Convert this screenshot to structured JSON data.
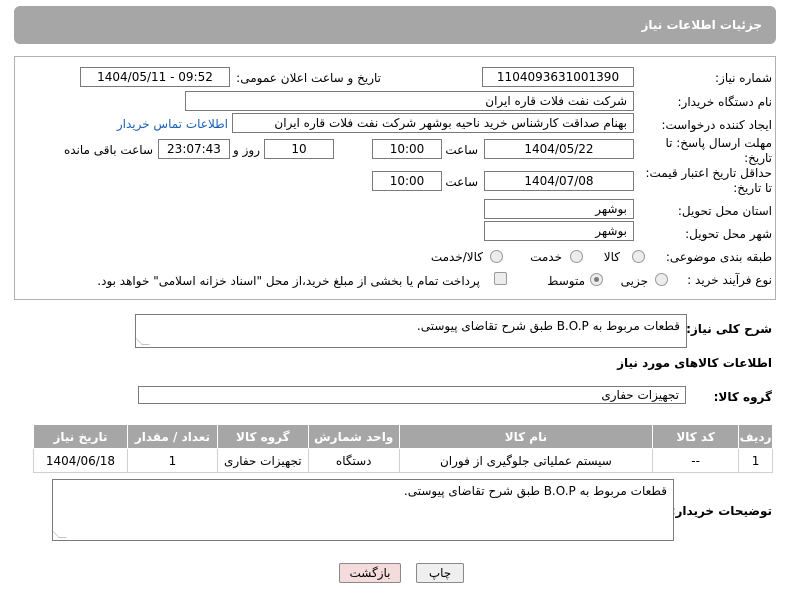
{
  "header": {
    "title": "جزئیات اطلاعات نیاز"
  },
  "form": {
    "need_number_label": "شماره نیاز:",
    "need_number": "1104093631001390",
    "announce_label": "تاریخ و ساعت اعلان عمومی:",
    "announce_value": "1404/05/11 - 09:52",
    "buyer_label": "نام دستگاه خریدار:",
    "buyer_value": "شرکت نفت فلات قاره ایران",
    "creator_label": "ایجاد کننده درخواست:",
    "creator_value": "بهنام  صداقت کارشناس خرید ناحیه بوشهر شرکت نفت فلات قاره ایران",
    "contact_link": "اطلاعات تماس خریدار",
    "reply_deadline_label": "مهلت ارسال پاسخ: تا تاریخ:",
    "reply_date": "1404/05/22",
    "time_label": "ساعت",
    "reply_time": "10:00",
    "days_value": "10",
    "days_label": "روز و",
    "remaining_time": "23:07:43",
    "remaining_label": "ساعت باقی مانده",
    "price_deadline_label": "حداقل تاریخ اعتبار قیمت: تا تاریخ:",
    "price_date": "1404/07/08",
    "price_time": "10:00",
    "province_label": "استان محل تحویل:",
    "province_value": "بوشهر",
    "city_label": "شهر محل تحویل:",
    "city_value": "بوشهر",
    "category_label": "طبقه بندی موضوعی:",
    "category_options": [
      "کالا",
      "خدمت",
      "کالا/خدمت"
    ],
    "process_label": "نوع فرآیند خرید :",
    "process_options": [
      "جزیی",
      "متوسط"
    ],
    "payment_note": "پرداخت تمام یا بخشی از مبلغ خرید،از محل \"اسناد خزانه اسلامی\" خواهد بود."
  },
  "summary": {
    "label": "شرح کلی نیاز:",
    "value": "قطعات مربوط به B.O.P طبق شرح تقاضای پیوستی."
  },
  "goods_info": {
    "title": "اطلاعات کالاهای مورد نیاز",
    "group_label": "گروه کالا:",
    "group_value": "تجهیزات حفاری"
  },
  "table": {
    "headers": [
      "ردیف",
      "کد کالا",
      "نام کالا",
      "واحد شمارش",
      "گروه کالا",
      "تعداد / مقدار",
      "تاریخ نیاز"
    ],
    "rows": [
      [
        "1",
        "--",
        "سیستم عملیاتی جلوگیری از فوران",
        "دستگاه",
        "تجهیزات حفاری",
        "1",
        "1404/06/18"
      ]
    ]
  },
  "buyer_notes": {
    "label": "توضیحات خریدار:",
    "value": "قطعات مربوط به B.O.P طبق شرح تقاضای پیوستی."
  },
  "buttons": {
    "print": "چاپ",
    "back": "بازگشت"
  },
  "watermark": "AriaTender.neT"
}
